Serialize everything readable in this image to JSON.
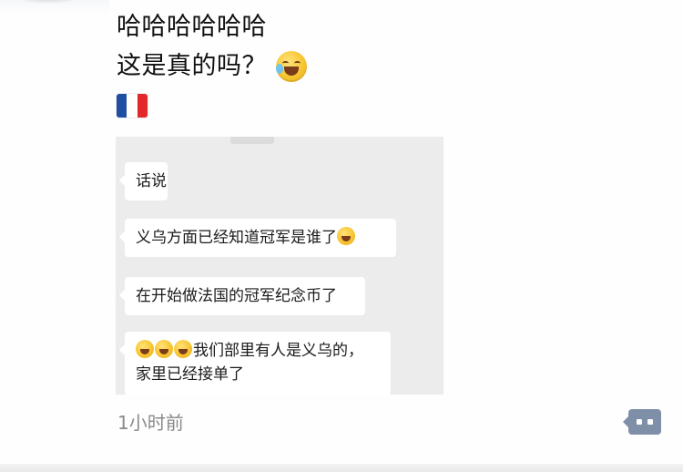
{
  "post": {
    "line1": "哈哈哈哈哈哈",
    "line2": "这是真的吗？",
    "line2_emoji": "laughing-crying-face-icon",
    "line3_flag": "france-flag-icon",
    "flag_colors": [
      "#1f4fa3",
      "#ffffff",
      "#e3282b"
    ]
  },
  "chat_screenshot": {
    "messages": [
      {
        "text": "话说"
      },
      {
        "text": "义乌方面已经知道冠军是谁了"
      },
      {
        "text": "在开始做法国的冠军纪念币了"
      },
      {
        "line1": "我们部里有人是义乌的，",
        "line2": "家里已经接单了"
      }
    ],
    "background": "#ececec"
  },
  "footer": {
    "timestamp": "1小时前",
    "comment_button": "comment-icon",
    "accent": "#7f8fa8"
  }
}
